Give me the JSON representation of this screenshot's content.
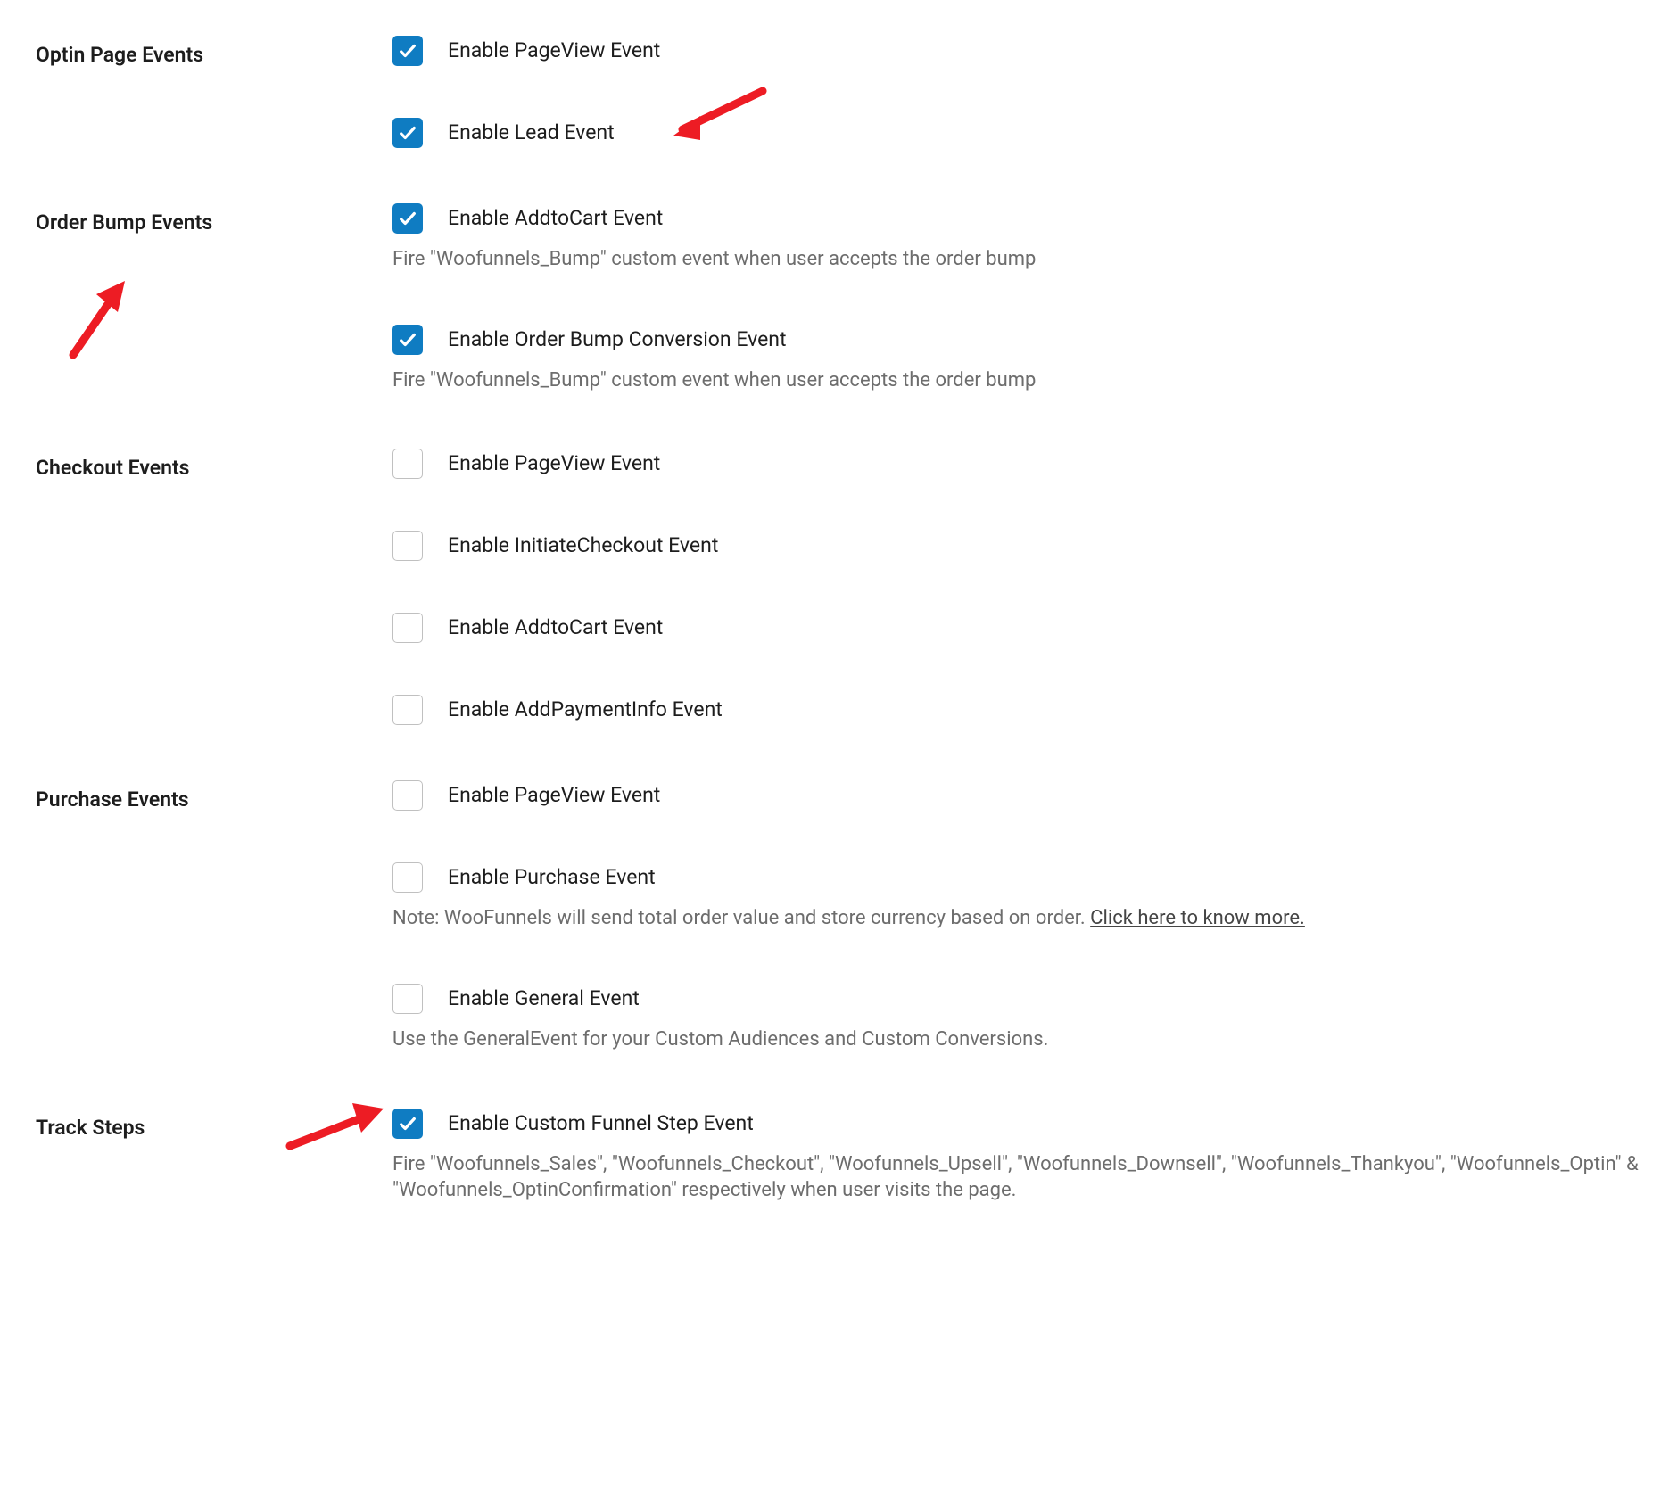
{
  "sections": {
    "optin": {
      "label": "Optin Page Events",
      "pageview": {
        "label": "Enable PageView Event",
        "checked": true
      },
      "lead": {
        "label": "Enable Lead Event",
        "checked": true
      }
    },
    "orderBump": {
      "label": "Order Bump Events",
      "addtocart": {
        "label": "Enable AddtoCart Event",
        "checked": true,
        "desc": "Fire \"Woofunnels_Bump\" custom event when user accepts the order bump"
      },
      "conversion": {
        "label": "Enable Order Bump Conversion Event",
        "checked": true,
        "desc": "Fire \"Woofunnels_Bump\" custom event when user accepts the order bump"
      }
    },
    "checkout": {
      "label": "Checkout Events",
      "pageview": {
        "label": "Enable PageView Event",
        "checked": false
      },
      "initiatecheckout": {
        "label": "Enable InitiateCheckout Event",
        "checked": false
      },
      "addtocart": {
        "label": "Enable AddtoCart Event",
        "checked": false
      },
      "addpaymentinfo": {
        "label": "Enable AddPaymentInfo Event",
        "checked": false
      }
    },
    "purchase": {
      "label": "Purchase Events",
      "pageview": {
        "label": "Enable PageView Event",
        "checked": false
      },
      "purchase": {
        "label": "Enable Purchase Event",
        "checked": false,
        "desc_prefix": "Note: WooFunnels will send total order value and store currency based on order. ",
        "desc_link": "Click here to know more."
      },
      "general": {
        "label": "Enable General Event",
        "checked": false,
        "desc": "Use the GeneralEvent for your Custom Audiences and Custom Conversions."
      }
    },
    "trackSteps": {
      "label": "Track Steps",
      "custom": {
        "label": "Enable Custom Funnel Step Event",
        "checked": true,
        "desc": "Fire \"Woofunnels_Sales\", \"Woofunnels_Checkout\", \"Woofunnels_Upsell\", \"Woofunnels_Downsell\", \"Woofunnels_Thankyou\", \"Woofunnels_Optin\" & \"Woofunnels_OptinConfirmation\" respectively when user visits the page."
      }
    }
  }
}
